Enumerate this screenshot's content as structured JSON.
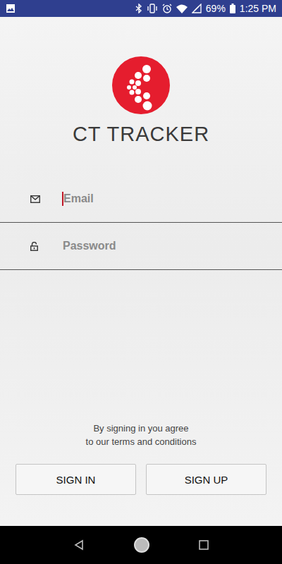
{
  "status_bar": {
    "battery": "69%",
    "time": "1:25 PM"
  },
  "app": {
    "name": "CT TRACKER"
  },
  "fields": [
    {
      "kind": "email",
      "placeholder": "Email",
      "focused": true
    },
    {
      "kind": "password",
      "placeholder": "Password",
      "focused": false
    }
  ],
  "terms": [
    "By signing in you agree",
    "to our terms and conditions"
  ],
  "buttons": [
    "SIGN IN",
    "SIGN UP"
  ]
}
